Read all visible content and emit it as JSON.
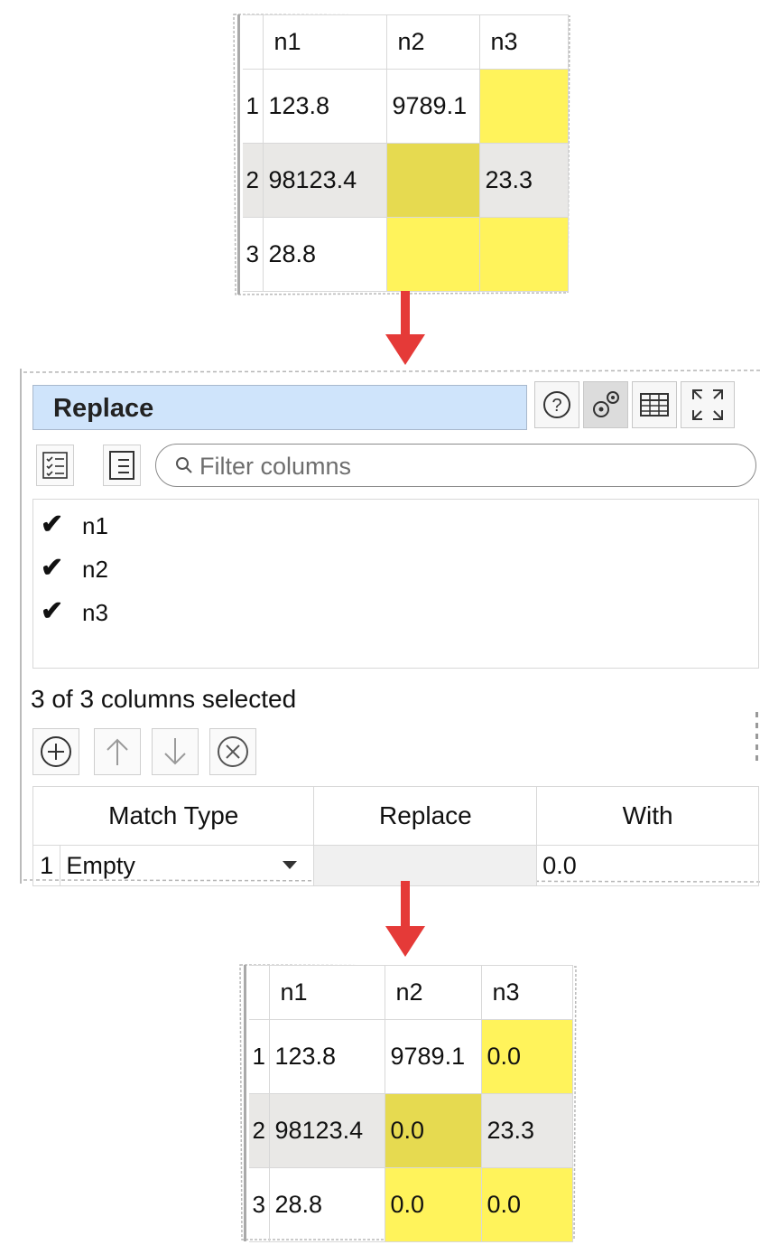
{
  "input_table": {
    "headers": [
      "n1",
      "n2",
      "n3"
    ],
    "rows": [
      {
        "num": "1",
        "n1": "123.8",
        "n2": "9789.1",
        "n3": ""
      },
      {
        "num": "2",
        "n1": "98123.4",
        "n2": "",
        "n3": "23.3"
      },
      {
        "num": "3",
        "n1": "28.8",
        "n2": "",
        "n3": ""
      }
    ]
  },
  "replace_panel": {
    "title": "Replace",
    "icons": [
      "help-icon",
      "gear-icon",
      "table-icon",
      "expand-icon"
    ],
    "filter_placeholder": "Filter columns",
    "columns": [
      {
        "label": "n1",
        "checked": true,
        "mark": "✔"
      },
      {
        "label": "n2",
        "checked": true,
        "mark": "✔"
      },
      {
        "label": "n3",
        "checked": true,
        "mark": "✔"
      }
    ],
    "selection_status": "3 of 3 columns selected",
    "rule_table": {
      "headers": [
        "Match Type",
        "Replace",
        "With"
      ],
      "rows": [
        {
          "num": "1",
          "match_type": "Empty",
          "replace": "",
          "with": "0.0"
        }
      ]
    }
  },
  "output_table": {
    "headers": [
      "n1",
      "n2",
      "n3"
    ],
    "rows": [
      {
        "num": "1",
        "n1": "123.8",
        "n2": "9789.1",
        "n3": "0.0"
      },
      {
        "num": "2",
        "n1": "98123.4",
        "n2": "0.0",
        "n3": "23.3"
      },
      {
        "num": "3",
        "n1": "28.8",
        "n2": "0.0",
        "n3": "0.0"
      }
    ]
  },
  "colors": {
    "highlight": "#fff35b",
    "highlight_alt_row": "#e6da50",
    "arrow": "#e53a38",
    "title_bar": "#cfe4fb"
  }
}
